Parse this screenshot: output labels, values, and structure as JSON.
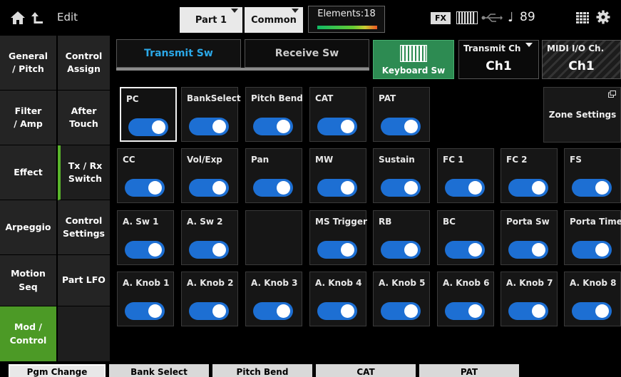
{
  "header": {
    "edit_label": "Edit",
    "part_label": "Part 1",
    "common_label": "Common",
    "elements_label": "Elements:18",
    "fx_label": "FX",
    "note_symbol": "♩",
    "tempo": "89"
  },
  "main_nav": [
    {
      "label": "General\n/ Pitch"
    },
    {
      "label": "Filter\n/ Amp"
    },
    {
      "label": "Effect"
    },
    {
      "label": "Arpeggio"
    },
    {
      "label": "Motion Seq"
    },
    {
      "label": "Mod /\nControl"
    }
  ],
  "sub_nav": [
    {
      "label": "Control\nAssign"
    },
    {
      "label": "After\nTouch"
    },
    {
      "label": "Tx / Rx\nSwitch"
    },
    {
      "label": "Control\nSettings"
    },
    {
      "label": "Part LFO"
    }
  ],
  "tabs": {
    "transmit": "Transmit Sw",
    "receive": "Receive Sw"
  },
  "keyboard_sw": "Keyboard Sw",
  "transmit_ch": {
    "title": "Transmit Ch",
    "value": "Ch1"
  },
  "midi_io": {
    "title": "MIDI I/O Ch.",
    "value": "Ch1"
  },
  "zone_settings": "Zone Settings",
  "switches": {
    "row1": [
      {
        "label": "PC",
        "on": true
      },
      {
        "label": "BankSelect",
        "on": true
      },
      {
        "label": "Pitch Bend",
        "on": true
      },
      {
        "label": "CAT",
        "on": true
      },
      {
        "label": "PAT",
        "on": true
      }
    ],
    "row2": [
      {
        "label": "CC",
        "on": true
      },
      {
        "label": "Vol/Exp",
        "on": true
      },
      {
        "label": "Pan",
        "on": true
      },
      {
        "label": "MW",
        "on": true
      },
      {
        "label": "Sustain",
        "on": true
      },
      {
        "label": "FC 1",
        "on": true
      },
      {
        "label": "FC 2",
        "on": true
      },
      {
        "label": "FS",
        "on": true
      }
    ],
    "row3": [
      {
        "label": "A. Sw 1",
        "on": true
      },
      {
        "label": "A. Sw 2",
        "on": true
      },
      {
        "label": "MS Trigger",
        "on": true
      },
      {
        "label": "RB",
        "on": true
      },
      {
        "label": "BC",
        "on": true
      },
      {
        "label": "Porta Sw",
        "on": true
      },
      {
        "label": "Porta Time",
        "on": true
      }
    ],
    "row4": [
      {
        "label": "A. Knob 1",
        "on": true
      },
      {
        "label": "A. Knob 2",
        "on": true
      },
      {
        "label": "A. Knob 3",
        "on": true
      },
      {
        "label": "A. Knob 4",
        "on": true
      },
      {
        "label": "A. Knob 5",
        "on": true
      },
      {
        "label": "A. Knob 6",
        "on": true
      },
      {
        "label": "A. Knob 7",
        "on": true
      },
      {
        "label": "A. Knob 8",
        "on": true
      }
    ]
  },
  "bottom_buttons": [
    {
      "label": "Pgm Change"
    },
    {
      "label": "Bank Select"
    },
    {
      "label": "Pitch Bend"
    },
    {
      "label": "CAT"
    },
    {
      "label": "PAT"
    }
  ],
  "colors": {
    "toggle_on": "#1d6fd3",
    "active_nav": "#4c9a26",
    "keyboard_sw": "#2d8b52",
    "tab_selected_text": "#2ba8e8"
  }
}
